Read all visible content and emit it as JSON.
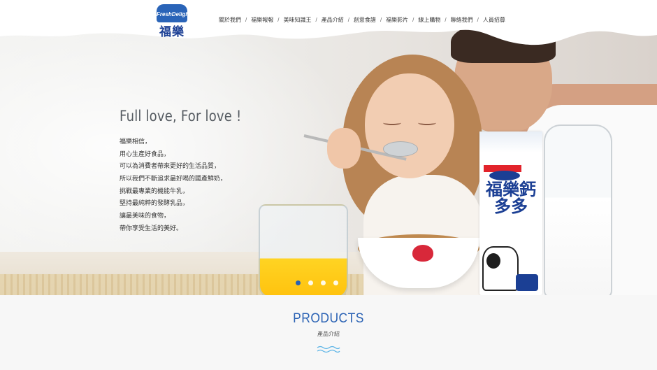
{
  "brand": {
    "logo_badge_text": "FreshDelight",
    "logo_wordmark": "福樂",
    "accent_color": "#2a62b4",
    "brand_navy": "#1b3f94"
  },
  "nav": {
    "items": [
      {
        "label": "關於我們"
      },
      {
        "label": "福樂報報"
      },
      {
        "label": "美味知識王"
      },
      {
        "label": "產品介紹"
      },
      {
        "label": "創意食譜"
      },
      {
        "label": "福樂影片"
      },
      {
        "label": "線上購物"
      },
      {
        "label": "聯絡我們"
      },
      {
        "label": "人員招募"
      }
    ],
    "separator": "/"
  },
  "hero": {
    "headline": "Full love, For love !",
    "lines": [
      "福樂相信，",
      "用心生產好食品，",
      "可以為消費者帶來更好的生活品質，",
      "所以我們不斷追求最好喝的國產鮮奶，",
      "挑戰最專業的機能牛乳，",
      "堅持最純粹的發酵乳品，",
      "讓最美味的食物，",
      "帶你享受生活的美好。"
    ],
    "carton_text": "福樂鈣多多",
    "slider": {
      "count": 4,
      "active_index": 0
    }
  },
  "products": {
    "title": "PRODUCTS",
    "subtitle": "產品介紹",
    "wave_icon": "wave-divider-icon"
  }
}
